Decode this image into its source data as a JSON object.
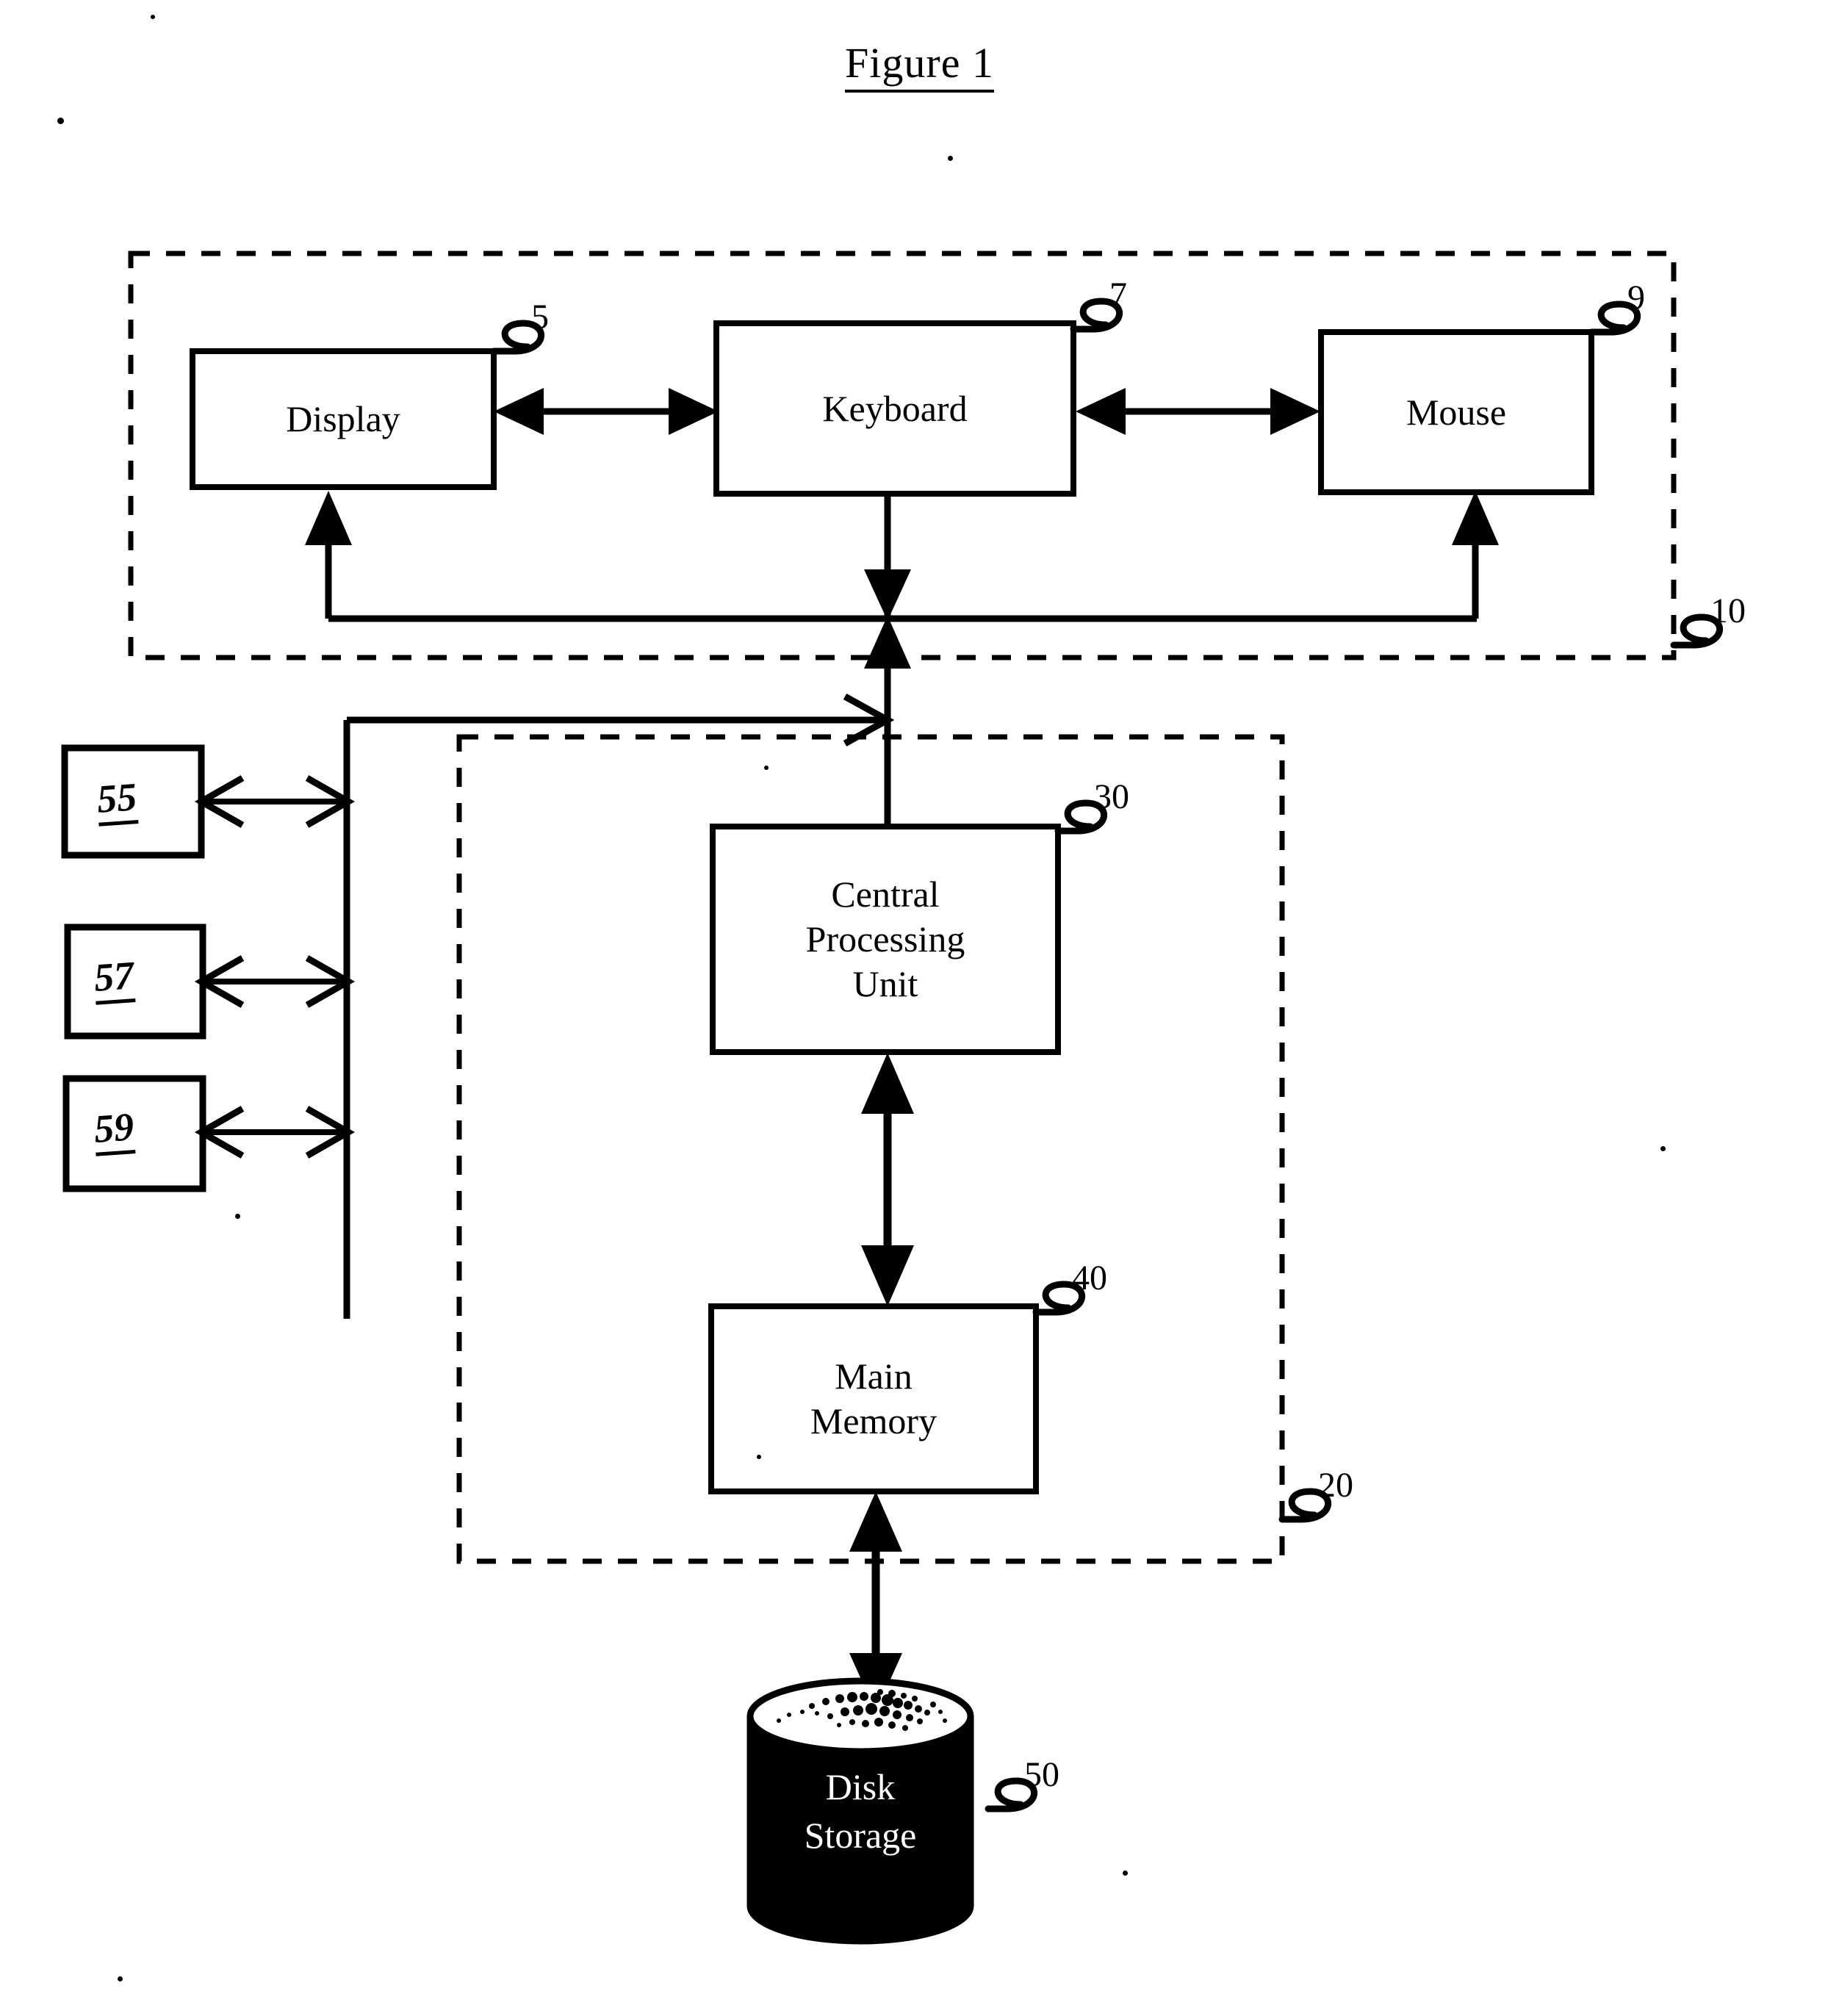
{
  "figure": {
    "title": "Figure 1",
    "type": "patent-block-diagram"
  },
  "blocks": {
    "display": {
      "label": "Display",
      "ref": "5"
    },
    "keyboard": {
      "label": "Keyboard",
      "ref": "7"
    },
    "mouse": {
      "label": "Mouse",
      "ref": "9"
    },
    "cpu": {
      "label": "Central\nProcessing\nUnit",
      "line1": "Central",
      "line2": "Processing",
      "line3": "Unit",
      "ref": "30"
    },
    "memory": {
      "label": "Main Memory",
      "line1": "Main",
      "line2": "Memory",
      "ref": "40"
    },
    "disk": {
      "label": "Disk Storage",
      "line1": "Disk",
      "line2": "Storage",
      "ref": "50"
    }
  },
  "peripherals": [
    {
      "label": "55"
    },
    {
      "label": "57"
    },
    {
      "label": "59"
    }
  ],
  "enclosures": {
    "io_group": {
      "ref": "10"
    },
    "computer_group": {
      "ref": "20"
    }
  },
  "colors": {
    "ink": "#000000",
    "paper": "#ffffff",
    "disk_fill": "#000000",
    "disk_text": "#ffffff"
  }
}
